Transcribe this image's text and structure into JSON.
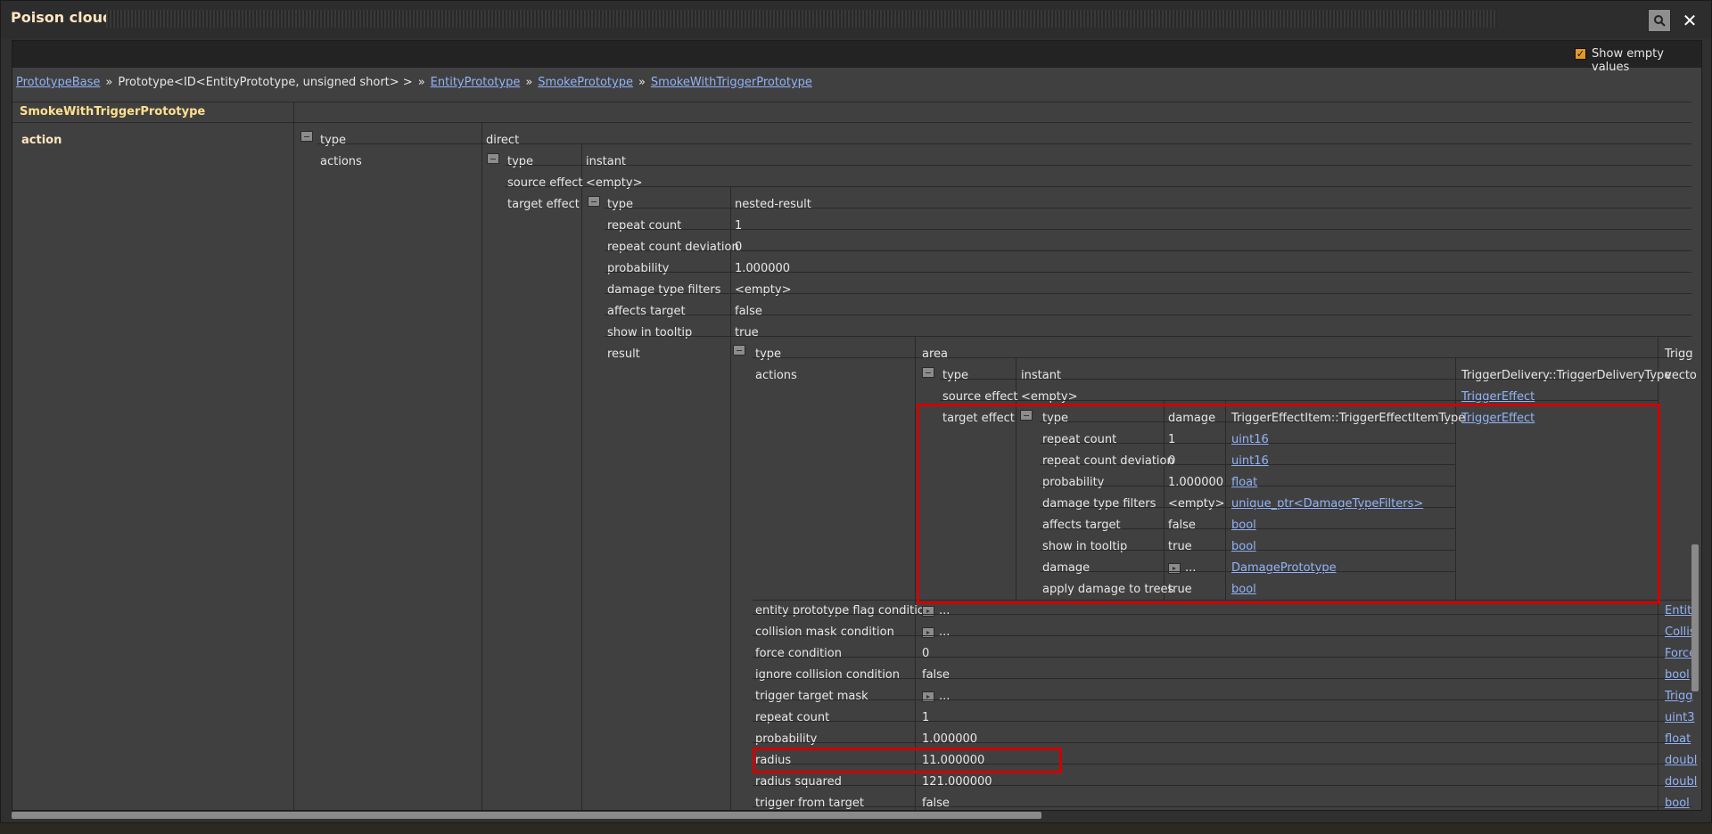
{
  "window": {
    "title": "Poison cloud"
  },
  "toolbar": {
    "show_empty_label": "Show empty values",
    "show_empty_checked": true
  },
  "breadcrumb": {
    "items": [
      {
        "text": "PrototypeBase",
        "link": true
      },
      {
        "text": "Prototype<ID<EntityPrototype, unsigned short> >",
        "link": false
      },
      {
        "text": "EntityPrototype",
        "link": true
      },
      {
        "text": "SmokePrototype",
        "link": true
      },
      {
        "text": "SmokeWithTriggerPrototype",
        "link": true
      }
    ],
    "separator": "»"
  },
  "table": {
    "header": "SmokeWithTriggerPrototype",
    "root_key": "action",
    "l1": {
      "type_key": "type",
      "type_val": "direct",
      "actions_key": "actions"
    },
    "l2": {
      "type_key": "type",
      "type_val": "instant",
      "source_key": "source effect",
      "source_val": "<empty>",
      "target_key": "target effect"
    },
    "l3": {
      "rows": [
        {
          "k": "type",
          "v": "nested-result"
        },
        {
          "k": "repeat count",
          "v": "1"
        },
        {
          "k": "repeat count deviation",
          "v": "0"
        },
        {
          "k": "probability",
          "v": "1.000000"
        },
        {
          "k": "damage type filters",
          "v": "<empty>"
        },
        {
          "k": "affects target",
          "v": "false"
        },
        {
          "k": "show in tooltip",
          "v": "true"
        }
      ],
      "result_key": "result"
    },
    "l4": {
      "type_key": "type",
      "type_val": "area",
      "type_ty": "Trigg",
      "actions_key": "actions",
      "actions_ty": "vecto",
      "rows": [
        {
          "k": "entity prototype flag condition",
          "v": "...",
          "ty": "Entity"
        },
        {
          "k": "collision mask condition",
          "v": "...",
          "ty": "Collis"
        },
        {
          "k": "force condition",
          "v": "0",
          "ty": "Force"
        },
        {
          "k": "ignore collision condition",
          "v": "false",
          "ty": "bool"
        },
        {
          "k": "trigger target mask",
          "v": "...",
          "ty": "Trigg"
        },
        {
          "k": "repeat count",
          "v": "1",
          "ty": "uint3"
        },
        {
          "k": "probability",
          "v": "1.000000",
          "ty": "float"
        },
        {
          "k": "radius",
          "v": "11.000000",
          "ty": "doubl"
        },
        {
          "k": "radius squared",
          "v": "121.000000",
          "ty": "doubl"
        },
        {
          "k": "trigger from target",
          "v": "false",
          "ty": "bool"
        }
      ]
    },
    "l5": {
      "type_key": "type",
      "type_val": "instant",
      "type_ty": "TriggerDelivery::TriggerDeliveryType",
      "source_key": "source effect",
      "source_val": "<empty>",
      "source_ty": "TriggerEffect",
      "target_key": "target effect",
      "target_ty": "TriggerEffect"
    },
    "l6": {
      "rows": [
        {
          "k": "type",
          "v": "damage",
          "ty": "TriggerEffectItem::TriggerEffectItemType",
          "link": false
        },
        {
          "k": "repeat count",
          "v": "1",
          "ty": "uint16",
          "link": true
        },
        {
          "k": "repeat count deviation",
          "v": "0",
          "ty": "uint16",
          "link": true
        },
        {
          "k": "probability",
          "v": "1.000000",
          "ty": "float",
          "link": true
        },
        {
          "k": "damage type filters",
          "v": "<empty>",
          "ty": "unique_ptr<DamageTypeFilters>",
          "link": true
        },
        {
          "k": "affects target",
          "v": "false",
          "ty": "bool",
          "link": true
        },
        {
          "k": "show in tooltip",
          "v": "true",
          "ty": "bool",
          "link": true
        },
        {
          "k": "damage",
          "v": "...",
          "ty": "DamagePrototype",
          "link": true
        },
        {
          "k": "apply damage to trees",
          "v": "true",
          "ty": "bool",
          "link": true
        }
      ]
    }
  }
}
